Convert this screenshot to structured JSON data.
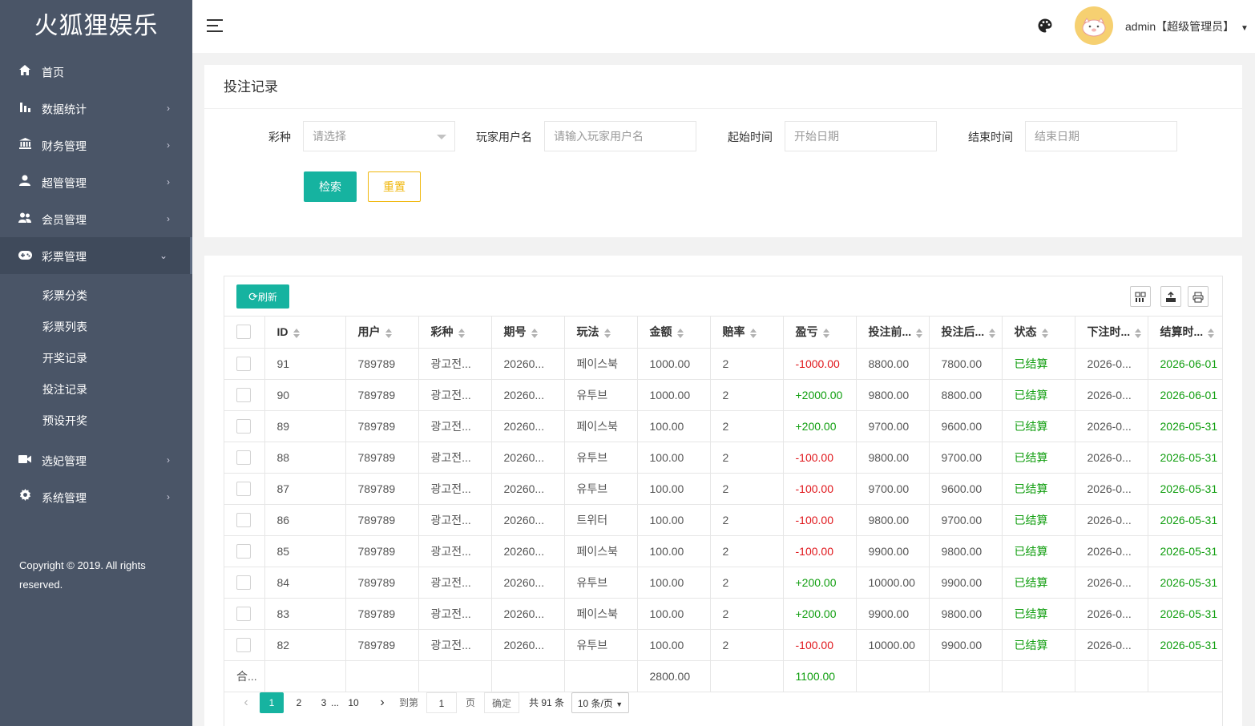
{
  "app": {
    "title": "火狐狸娱乐"
  },
  "sidebar": {
    "items": [
      {
        "label": "首页",
        "icon": "home-icon",
        "has_children": false
      },
      {
        "label": "数据统计",
        "icon": "bar-chart-icon",
        "has_children": true
      },
      {
        "label": "财务管理",
        "icon": "bank-icon",
        "has_children": true
      },
      {
        "label": "超管管理",
        "icon": "user-icon",
        "has_children": true
      },
      {
        "label": "会员管理",
        "icon": "users-icon",
        "has_children": true
      },
      {
        "label": "彩票管理",
        "icon": "gamepad-icon",
        "has_children": true,
        "open": true
      },
      {
        "label": "选妃管理",
        "icon": "video-icon",
        "has_children": true
      },
      {
        "label": "系统管理",
        "icon": "gear-icon",
        "has_children": true
      }
    ],
    "sub_items": [
      "彩票分类",
      "彩票列表",
      "开奖记录",
      "投注记录",
      "预设开奖"
    ],
    "copyright": "Copyright © 2019. All rights reserved."
  },
  "header": {
    "user": "admin【超级管理员】"
  },
  "search": {
    "title": "投注记录",
    "lottery_label": "彩种",
    "lottery_placeholder": "请选择",
    "player_label": "玩家用户名",
    "player_placeholder": "请输入玩家用户名",
    "start_label": "起始时间",
    "start_placeholder": "开始日期",
    "end_label": "结束时间",
    "end_placeholder": "结束日期",
    "search_btn": "检索",
    "reset_btn": "重置"
  },
  "table": {
    "refresh_btn": "刷新",
    "columns": [
      "ID",
      "用户",
      "彩种",
      "期号",
      "玩法",
      "金额",
      "赔率",
      "盈亏",
      "投注前...",
      "投注后...",
      "状态",
      "下注时...",
      "结算时..."
    ],
    "rows": [
      {
        "id": "91",
        "user": "789789",
        "lottery": "광고전...",
        "issue": "20260...",
        "play": "페이스북",
        "amount": "1000.00",
        "odds": "2",
        "profit": "-1000.00",
        "before": "8800.00",
        "after": "7800.00",
        "status": "已结算",
        "bet_time": "2026-0...",
        "settle_time": "2026-06-01"
      },
      {
        "id": "90",
        "user": "789789",
        "lottery": "광고전...",
        "issue": "20260...",
        "play": "유투브",
        "amount": "1000.00",
        "odds": "2",
        "profit": "+2000.00",
        "before": "9800.00",
        "after": "8800.00",
        "status": "已结算",
        "bet_time": "2026-0...",
        "settle_time": "2026-06-01"
      },
      {
        "id": "89",
        "user": "789789",
        "lottery": "광고전...",
        "issue": "20260...",
        "play": "페이스북",
        "amount": "100.00",
        "odds": "2",
        "profit": "+200.00",
        "before": "9700.00",
        "after": "9600.00",
        "status": "已结算",
        "bet_time": "2026-0...",
        "settle_time": "2026-05-31"
      },
      {
        "id": "88",
        "user": "789789",
        "lottery": "광고전...",
        "issue": "20260...",
        "play": "유투브",
        "amount": "100.00",
        "odds": "2",
        "profit": "-100.00",
        "before": "9800.00",
        "after": "9700.00",
        "status": "已结算",
        "bet_time": "2026-0...",
        "settle_time": "2026-05-31"
      },
      {
        "id": "87",
        "user": "789789",
        "lottery": "광고전...",
        "issue": "20260...",
        "play": "유투브",
        "amount": "100.00",
        "odds": "2",
        "profit": "-100.00",
        "before": "9700.00",
        "after": "9600.00",
        "status": "已结算",
        "bet_time": "2026-0...",
        "settle_time": "2026-05-31"
      },
      {
        "id": "86",
        "user": "789789",
        "lottery": "광고전...",
        "issue": "20260...",
        "play": "트위터",
        "amount": "100.00",
        "odds": "2",
        "profit": "-100.00",
        "before": "9800.00",
        "after": "9700.00",
        "status": "已结算",
        "bet_time": "2026-0...",
        "settle_time": "2026-05-31"
      },
      {
        "id": "85",
        "user": "789789",
        "lottery": "광고전...",
        "issue": "20260...",
        "play": "페이스북",
        "amount": "100.00",
        "odds": "2",
        "profit": "-100.00",
        "before": "9900.00",
        "after": "9800.00",
        "status": "已结算",
        "bet_time": "2026-0...",
        "settle_time": "2026-05-31"
      },
      {
        "id": "84",
        "user": "789789",
        "lottery": "광고전...",
        "issue": "20260...",
        "play": "유투브",
        "amount": "100.00",
        "odds": "2",
        "profit": "+200.00",
        "before": "10000.00",
        "after": "9900.00",
        "status": "已结算",
        "bet_time": "2026-0...",
        "settle_time": "2026-05-31"
      },
      {
        "id": "83",
        "user": "789789",
        "lottery": "광고전...",
        "issue": "20260...",
        "play": "페이스북",
        "amount": "100.00",
        "odds": "2",
        "profit": "+200.00",
        "before": "9900.00",
        "after": "9800.00",
        "status": "已结算",
        "bet_time": "2026-0...",
        "settle_time": "2026-05-31"
      },
      {
        "id": "82",
        "user": "789789",
        "lottery": "광고전...",
        "issue": "20260...",
        "play": "유투브",
        "amount": "100.00",
        "odds": "2",
        "profit": "-100.00",
        "before": "10000.00",
        "after": "9900.00",
        "status": "已结算",
        "bet_time": "2026-0...",
        "settle_time": "2026-05-31"
      }
    ],
    "total": {
      "label": "合...",
      "amount": "2800.00",
      "profit": "1100.00"
    }
  },
  "pagination": {
    "pages": [
      "1",
      "2",
      "3",
      "...",
      "10"
    ],
    "current": "1",
    "goto_label": "到第",
    "goto_value": "1",
    "page_unit": "页",
    "confirm": "确定",
    "total": "共 91 条",
    "page_size": "10 条/页"
  },
  "colors": {
    "accent": "#16b3a0",
    "warn": "#f0b70c",
    "sidebar": "#4a5567",
    "loss": "#e0161b",
    "gain": "#109e0f"
  }
}
